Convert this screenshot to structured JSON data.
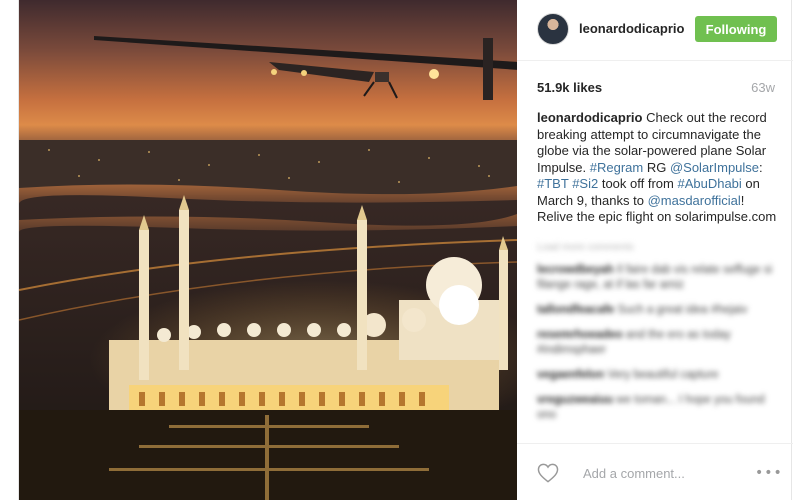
{
  "post": {
    "username": "leonardodicaprio",
    "follow_label": "Following",
    "likes": "51.9k likes",
    "age": "63w",
    "caption": {
      "user": "leonardodicaprio",
      "t1": " Check out the record breaking attempt to circumnavigate the globe via the solar-powered plane Solar Impulse. ",
      "tag1": "#Regram",
      "t2": " RG ",
      "mention1": "@SolarImpulse",
      "t3": ": ",
      "tag2": "#TBT",
      "t4": " ",
      "tag3": "#Si2",
      "t5": " took off from ",
      "tag4": "#AbuDhabi",
      "t6": " on March 9, thanks to ",
      "mention2": "@masdarofficial",
      "t7": "! Relive the epic flight on solarimpulse.com"
    },
    "blurred_comments": [
      {
        "user": "",
        "text": "Load more comments"
      },
      {
        "user": "lecrowdbeyah",
        "text": "Il faire dab vis relate seffuge si filange rage, at if las far amiz"
      },
      {
        "user": "tallondfeacafe",
        "text": "Such a great idea #hejaiv"
      },
      {
        "user": "resemrhoeadeo",
        "text": "and the ero as today #indimsphaer"
      },
      {
        "user": "vegaenfelon",
        "text": "Very beautiful capture"
      },
      {
        "user": "vreguzweaiuu",
        "text": "we toman... I hope you found ono"
      }
    ]
  },
  "footer": {
    "comment_placeholder": "Add a comment...",
    "more_label": "•••"
  },
  "icons": {
    "like": "heart-outline-icon",
    "more": "ellipsis-icon"
  },
  "colors": {
    "follow_green": "#70c050",
    "link_blue": "#3f729b",
    "muted_gray": "#a5a7aa"
  }
}
